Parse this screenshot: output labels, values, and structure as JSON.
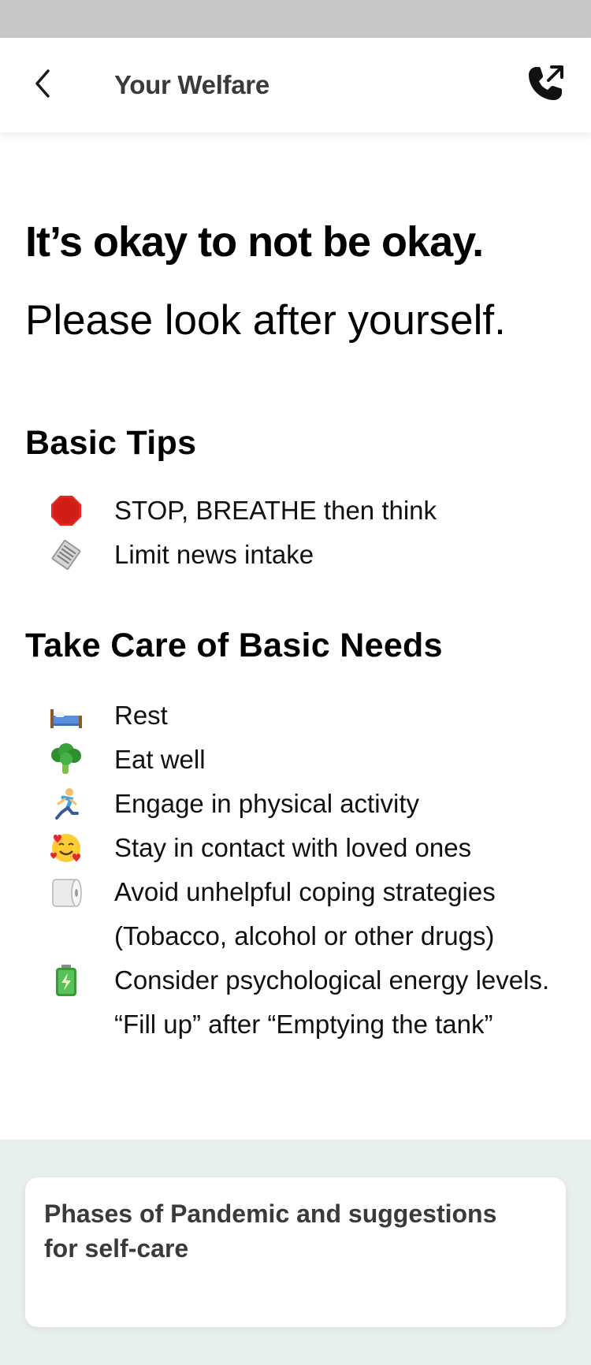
{
  "header": {
    "title": "Your Welfare",
    "back_icon": "chevron-left-icon",
    "call_icon": "phone-outgoing-icon"
  },
  "main": {
    "headline": "It’s okay to not be okay.",
    "subheadline": "Please look after yourself.",
    "basic_tips": {
      "title": "Basic Tips",
      "items": [
        {
          "icon": "stop-sign-icon",
          "text": "STOP, BREATHE then think"
        },
        {
          "icon": "newspaper-icon",
          "text": "Limit news intake"
        }
      ]
    },
    "basic_needs": {
      "title": "Take Care of Basic Needs",
      "items": [
        {
          "icon": "bed-icon",
          "text": "Rest"
        },
        {
          "icon": "broccoli-icon",
          "text": "Eat well"
        },
        {
          "icon": "runner-icon",
          "text": "Engage in physical activity"
        },
        {
          "icon": "smiling-face-hearts-icon",
          "text": "Stay in contact with loved ones"
        },
        {
          "icon": "toilet-paper-icon",
          "text": "Avoid unhelpful coping strategies (Tobacco, alcohol or other drugs)"
        },
        {
          "icon": "battery-icon",
          "text": "Consider psychological energy levels. “Fill up” after “Emptying the tank”"
        }
      ]
    }
  },
  "card": {
    "title": "Phases of Pandemic and suggestions for self-care"
  },
  "colors": {
    "status_bar": "#c8c8c8",
    "header_text": "#3a3a3a",
    "bottom_background": "#e8f0ee",
    "card_background": "#ffffff"
  }
}
